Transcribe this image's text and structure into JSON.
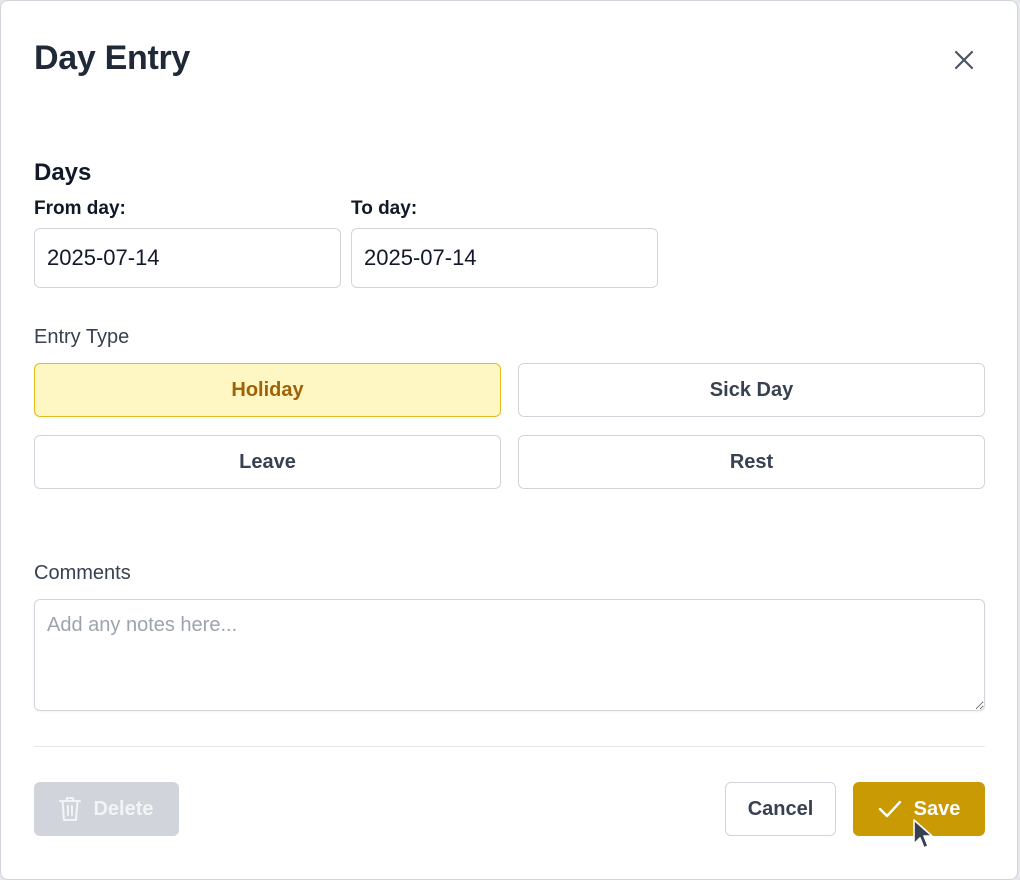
{
  "dialog": {
    "title": "Day Entry",
    "close_icon": "close-icon"
  },
  "days": {
    "section_title": "Days",
    "from_label": "From day:",
    "from_value": "2025-07-14",
    "to_label": "To day:",
    "to_value": "2025-07-14"
  },
  "entry_type": {
    "label": "Entry Type",
    "selected": "Holiday",
    "options": [
      "Holiday",
      "Sick Day",
      "Leave",
      "Rest"
    ]
  },
  "comments": {
    "label": "Comments",
    "placeholder": "Add any notes here...",
    "value": ""
  },
  "footer": {
    "delete_label": "Delete",
    "delete_icon": "trash-icon",
    "delete_disabled": true,
    "cancel_label": "Cancel",
    "save_label": "Save",
    "save_icon": "check-icon"
  },
  "colors": {
    "accent": "#ca9a04",
    "selected_bg": "#fef7c3",
    "selected_border": "#e6bc1c",
    "selected_text": "#a16207",
    "disabled_bg": "#d1d5db"
  }
}
